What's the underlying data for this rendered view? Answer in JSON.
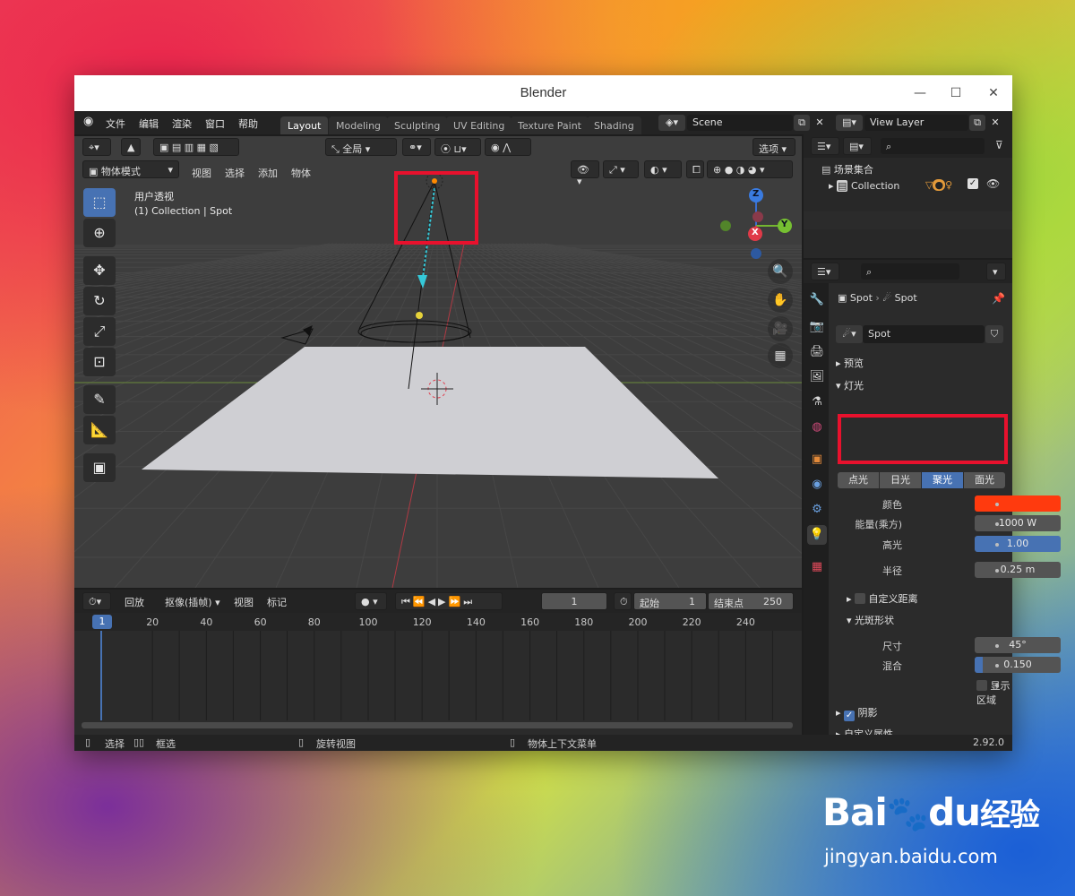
{
  "window": {
    "title": "Blender"
  },
  "menu": [
    "文件",
    "编辑",
    "渲染",
    "窗口",
    "帮助"
  ],
  "workspace_tabs": [
    {
      "label": "Layout",
      "active": true
    },
    {
      "label": "Modeling",
      "active": false
    },
    {
      "label": "Sculpting",
      "active": false
    },
    {
      "label": "UV Editing",
      "active": false
    },
    {
      "label": "Texture Paint",
      "active": false
    },
    {
      "label": "Shading",
      "active": false
    }
  ],
  "scene": {
    "name": "Scene"
  },
  "view_layer": {
    "name": "View Layer"
  },
  "viewport": {
    "transform_orientation": "全局",
    "options_label": "选项",
    "mode": "物体模式",
    "menus": [
      "视图",
      "选择",
      "添加",
      "物体"
    ],
    "view_name": "用户透视",
    "active_info": "(1) Collection | Spot",
    "gizmo": {
      "z": "Z",
      "y": "Y",
      "x": "X"
    }
  },
  "timeline": {
    "playback_label": "回放",
    "keying_label": "抠像(插帧)",
    "view_label": "视图",
    "marker_label": "标记",
    "current_frame": "1",
    "start_label": "起始",
    "start": "1",
    "end_label": "结束点",
    "end": "250",
    "playhead": "1",
    "ticks": [
      "20",
      "40",
      "60",
      "80",
      "100",
      "120",
      "140",
      "160",
      "180",
      "200",
      "220",
      "240"
    ]
  },
  "outliner": {
    "root": "场景集合",
    "collection": "Collection"
  },
  "properties": {
    "object_name": "Spot",
    "data_name": "Spot",
    "light_data": "Spot",
    "sections": {
      "preview": "预览",
      "light": "灯光",
      "custom_distance": "自定义距离",
      "spot_shape": "光斑形状",
      "shadow": "阴影",
      "custom_props": "自定义属性"
    },
    "light_types": [
      "点光",
      "日光",
      "聚光",
      "面光"
    ],
    "active_light_type": "聚光",
    "color_label": "颜色",
    "color_value": "#ff3a0e",
    "power_label": "能量(乘方)",
    "power_value": "1000 W",
    "specular_label": "高光",
    "specular_value": "1.00",
    "radius_label": "半径",
    "radius_value": "0.25 m",
    "size_label": "尺寸",
    "size_value": "45°",
    "blend_label": "混合",
    "blend_value": "0.150",
    "show_cone_label": "显示区域"
  },
  "statusbar": {
    "select": "选择",
    "box_select": "框选",
    "rotate_view": "旋转视图",
    "context_menu": "物体上下文菜单",
    "version": "2.92.0"
  },
  "watermark": {
    "brand_a": "Bai",
    "brand_b": "du",
    "brand_c": "经验",
    "url": "jingyan.baidu.com"
  },
  "colors": {
    "accent": "#4772b3",
    "annotation": "#e8112d",
    "light_color": "#ff3a0e"
  }
}
